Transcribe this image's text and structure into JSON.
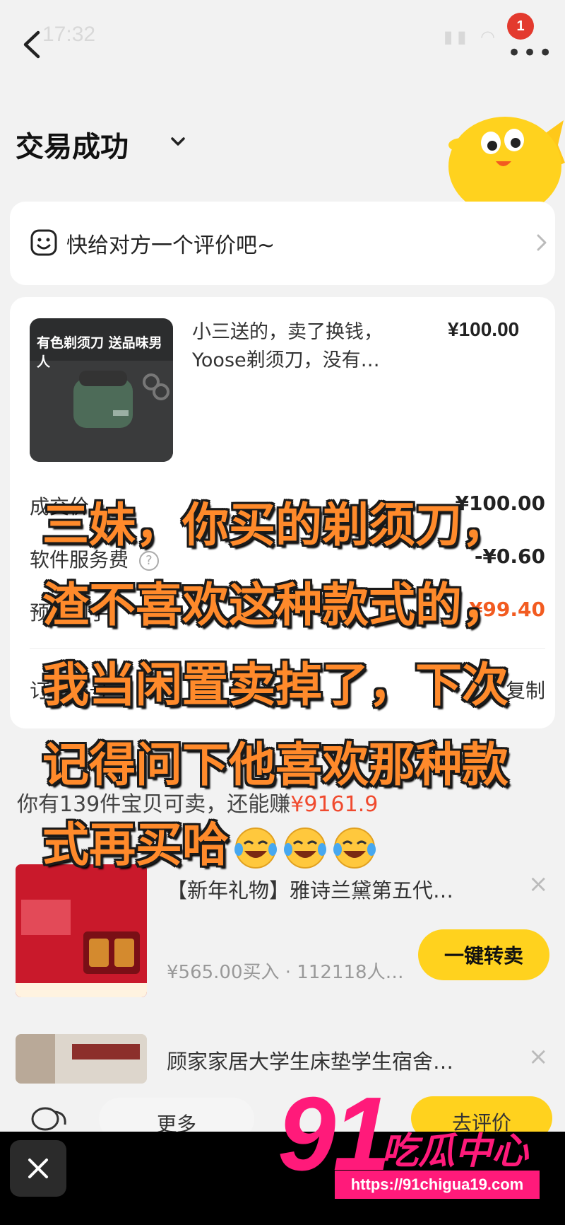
{
  "status_bar": {
    "time": "17:32",
    "badge_count": "1"
  },
  "header": {
    "title": "交易成功"
  },
  "review_prompt": {
    "text": "快给对方一个评价吧~"
  },
  "order": {
    "image_caption": "有色剃须刀 送品味男人",
    "item_desc": "小三送的，卖了换钱，Yoose剃须刀，没有…",
    "price": "¥100.00",
    "row1_label": "成交价",
    "row1_value": "¥100.00",
    "row2_label": "软件服务费",
    "row2_value": "-¥0.60",
    "row3_label": "预估到手",
    "row3_value": "¥99.40",
    "row4_label": "订单编号",
    "row4_value": "复制"
  },
  "resell": {
    "heading_prefix": "你有139件宝贝可卖，还能赚",
    "heading_amount": "¥9161.9",
    "item1_title": "【新年礼物】雅诗兰黛第五代…",
    "item1_sub": "¥565.00买入 · 112118人…",
    "item1_button": "一键转卖",
    "item2_title": "顾家家居大学生床垫学生宿舍…"
  },
  "bottom_bar": {
    "more_label": "更多",
    "review_label": "去评价"
  },
  "watermark": {
    "number": "91",
    "text": "吃瓜中心",
    "url": "https://91chigua19.com"
  },
  "caption": {
    "text": "三妹，你买的剃须刀，渣不喜欢这种款式的，我当闲置卖掉了，下次记得问下他喜欢那种款式再买哈"
  },
  "colors": {
    "accent_yellow": "#ffd21e",
    "price_orange": "#f25b20",
    "caption_orange": "#ff8a2b",
    "watermark_pink": "#ff1a7a"
  }
}
